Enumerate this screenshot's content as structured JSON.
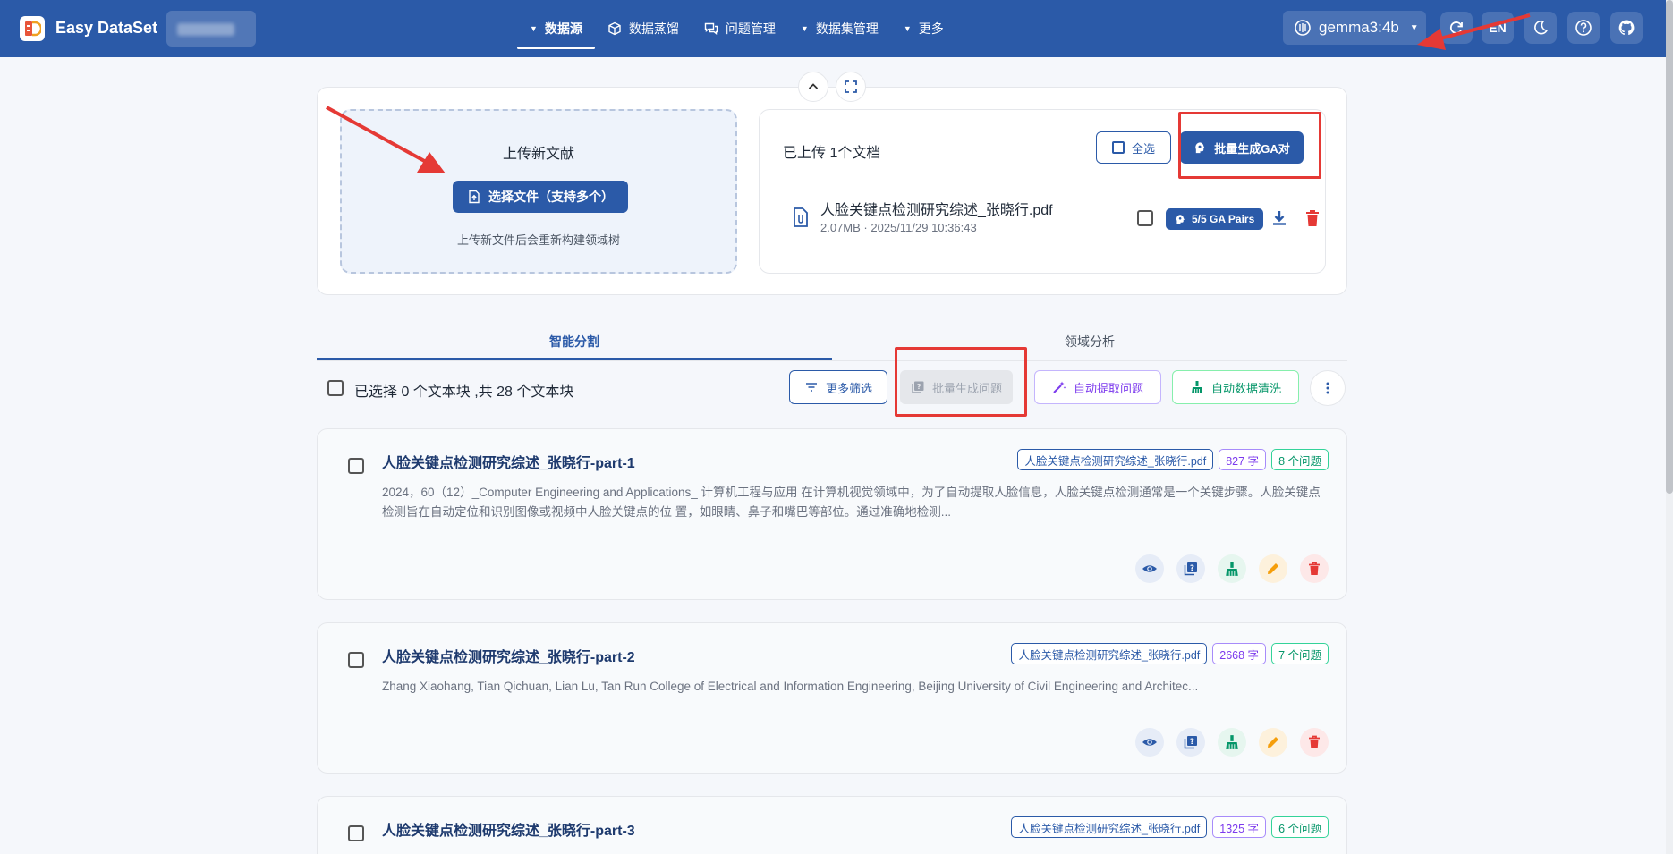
{
  "app": {
    "brand": "Easy DataSet",
    "model": "gemma3:4b",
    "lang_button": "EN"
  },
  "nav": {
    "items": [
      {
        "label": "数据源",
        "active": true
      },
      {
        "label": "数据蒸馏"
      },
      {
        "label": "问题管理"
      },
      {
        "label": "数据集管理"
      },
      {
        "label": "更多"
      }
    ]
  },
  "upload": {
    "title": "上传新文献",
    "select_button": "选择文件（支持多个）",
    "hint": "上传新文件后会重新构建领域树"
  },
  "documents": {
    "title": "已上传 1个文档",
    "select_all": "全选",
    "batch_ga": "批量生成GA对",
    "items": [
      {
        "name": "人脸关键点检测研究综述_张晓行.pdf",
        "meta": "2.07MB · 2025/11/29 10:36:43",
        "ga_badge": "5/5 GA Pairs"
      }
    ]
  },
  "tabs": [
    {
      "label": "智能分割",
      "active": true
    },
    {
      "label": "领域分析"
    }
  ],
  "toolbar": {
    "selection": "已选择 0 个文本块 ,共 28 个文本块",
    "more_filter": "更多筛选",
    "batch_questions": "批量生成问题",
    "auto_extract": "自动提取问题",
    "auto_clean": "自动数据清洗"
  },
  "chunks": [
    {
      "title": "人脸关键点检测研究综述_张晓行-part-1",
      "file": "人脸关键点检测研究综述_张晓行.pdf",
      "chars": "827 字",
      "questions": "8 个问题",
      "content": "2024，60（12）_Computer Engineering and Applications_ 计算机工程与应用 在计算机视觉领域中，为了自动提取人脸信息，人脸关键点检测通常是一个关键步骤。人脸关键点检测旨在自动定位和识别图像或视频中人脸关键点的位 置，如眼睛、鼻子和嘴巴等部位。通过准确地检测..."
    },
    {
      "title": "人脸关键点检测研究综述_张晓行-part-2",
      "file": "人脸关键点检测研究综述_张晓行.pdf",
      "chars": "2668 字",
      "questions": "7 个问题",
      "content": "Zhang Xiaohang, Tian Qichuan, Lian Lu, Tan Run College of Electrical and Information Engineering, Beijing University of Civil Engineering and Architec..."
    },
    {
      "title": "人脸关键点检测研究综述_张晓行-part-3",
      "file": "人脸关键点检测研究综述_张晓行.pdf",
      "chars": "1325 字",
      "questions": "6 个问题",
      "content": ""
    }
  ],
  "colors": {
    "primary": "#2b5aa8",
    "annotation_red": "#e53935"
  }
}
